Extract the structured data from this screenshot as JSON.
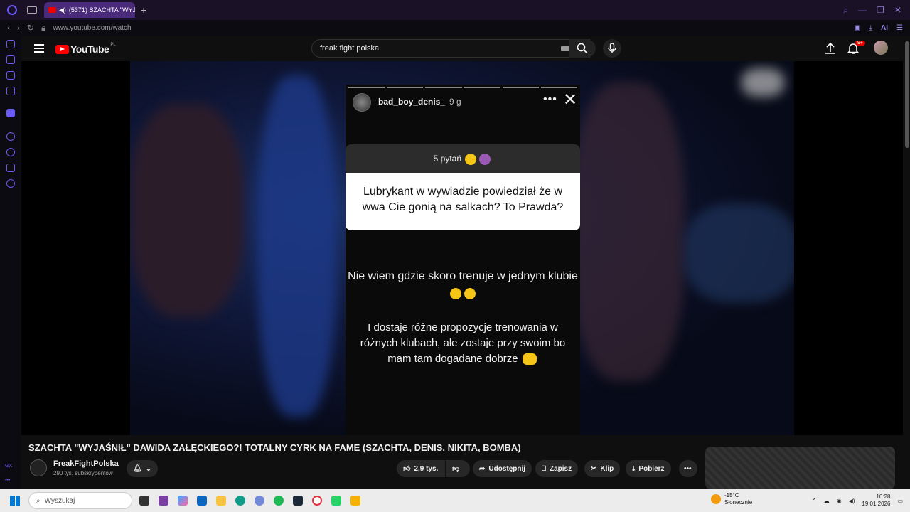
{
  "browser": {
    "tab_title": "(5371) SZACHTA \"WYJ...",
    "url": "www.youtube.com/watch",
    "ai_label": "AI"
  },
  "youtube": {
    "logo_text": "YouTube",
    "region": "PL",
    "search_value": "freak fight polska",
    "notif_badge": "9+"
  },
  "story": {
    "username": "bad_boy_denis_",
    "time": "9 g",
    "question_header": "5 pytań",
    "question": "Lubrykant w wywiadzie powiedział że w wwa Cie gonią na salkach? To Prawda?",
    "answer1": "Nie wiem gdzie skoro trenuje w jednym klubie",
    "answer2": "I dostaje różne propozycje trenowania w różnych klubach, ale zostaje przy swoim bo mam tam dogadane  dobrze"
  },
  "video": {
    "title": "SZACHTA \"WYJAŚNIŁ\" DAWIDA ZAŁĘCKIEGO?! TOTALNY CYRK NA FAME (SZACHTA, DENIS, NIKITA, BOMBA)",
    "channel": "FreakFightPolska",
    "subscribers": "290 tys. subskrybentów",
    "likes": "2,9 tys.",
    "share": "Udostępnij",
    "save": "Zapisz",
    "clip": "Klip",
    "download": "Pobierz"
  },
  "sidebar": {
    "label_gx": "GX"
  },
  "taskbar": {
    "search_placeholder": "Wyszukaj",
    "weather_temp": "-15°C",
    "weather_desc": "Słonecznie",
    "time": "10:28",
    "date": "19.01.2026",
    "notif_count": "5"
  }
}
